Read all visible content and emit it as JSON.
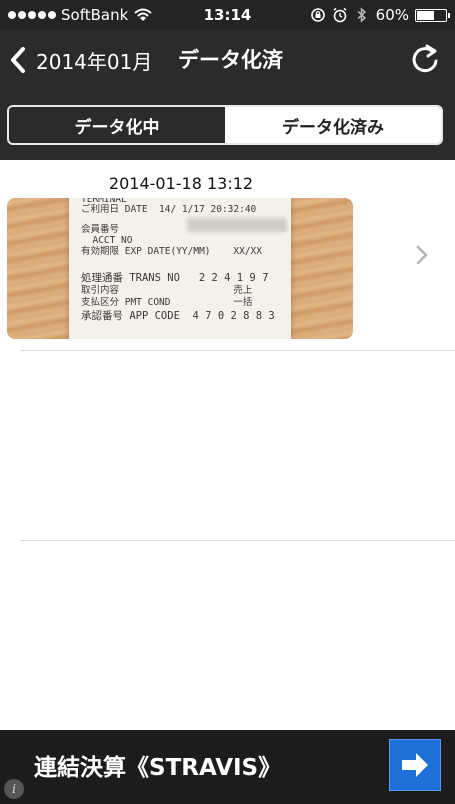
{
  "status_bar": {
    "carrier": "SoftBank",
    "time": "13:14",
    "battery_label": "60%",
    "battery_level": 0.6,
    "icons": [
      "signal-dots-icon",
      "wifi-icon",
      "rotation-lock-icon",
      "alarm-icon",
      "bluetooth-icon",
      "battery-icon"
    ]
  },
  "nav": {
    "back_label": "2014年01月",
    "title": "データ化済",
    "back_icon": "chevron-left-icon",
    "refresh_icon": "refresh-icon"
  },
  "segments": {
    "items": [
      "データ化中",
      "データ化済み"
    ],
    "selected": "データ化済み"
  },
  "records": [
    {
      "datetime": "2014-01-18 13:12",
      "receipt_lines": [
        "TERMINAL",
        "ご利用日 DATE  14/ 1/17 20:32:40",
        "会員番号",
        "  ACCT NO",
        "有効期限 EXP DATE(YY/MM)    XX/XX",
        "処理通番 TRANS NO   2 2 4 1 9 7",
        "取引内容                    売上",
        "支払区分 PMT COND           一括",
        "承認番号 APP CODE  4 7 0 2 8 8 3"
      ]
    }
  ],
  "banner": {
    "text": "連結決算《STRAVIS》",
    "button_icon": "arrow-right-icon",
    "button_color": "#1f6fd9",
    "info_icon": "info-icon",
    "info_glyph": "i"
  }
}
